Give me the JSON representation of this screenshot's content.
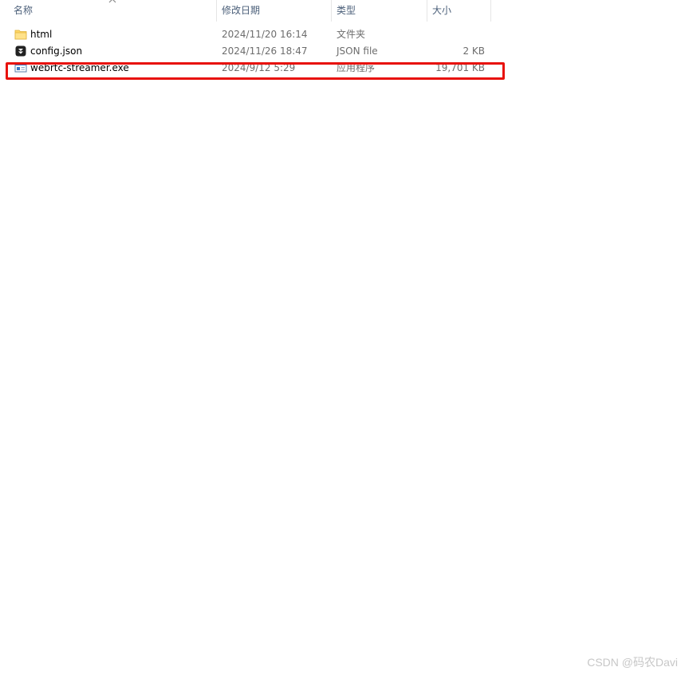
{
  "columns": {
    "name": "名称",
    "modified": "修改日期",
    "type": "类型",
    "size": "大小"
  },
  "sort_indicator_icon": "chevron-up-icon",
  "files": [
    {
      "name": "html",
      "modified": "2024/11/20 16:14",
      "type": "文件夹",
      "size": "",
      "icon": "folder-icon"
    },
    {
      "name": "config.json",
      "modified": "2024/11/26 18:47",
      "type": "JSON file",
      "size": "2 KB",
      "icon": "json-file-icon"
    },
    {
      "name": "webrtc-streamer.exe",
      "modified": "2024/9/12 5:29",
      "type": "应用程序",
      "size": "19,701 KB",
      "icon": "executable-icon"
    }
  ],
  "highlight_color": "#e8120c",
  "watermark": "CSDN @码农Davi"
}
